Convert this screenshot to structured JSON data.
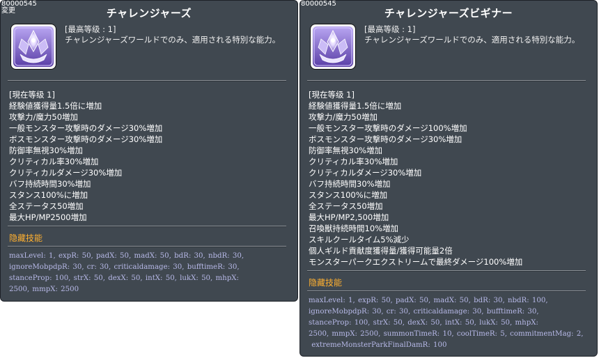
{
  "left": {
    "id": "80000545",
    "changed": "変更",
    "title": "チャレンジャーズ",
    "max_level": "[最高等级 : 1]",
    "description": "チャレンジャーズワールドでのみ、適用される特別な能力。",
    "current_level": "[現在等级 1]",
    "stats": [
      "経験値獲得量1.5倍に増加",
      "攻撃力/魔力50増加",
      "一般モンスター攻撃時のダメージ30%増加",
      "ボスモンスター攻撃時のダメージ30%増加",
      "防御率無視30%増加",
      "クリティカル率30%増加",
      "クリティカルダメージ30%増加",
      "バフ持続時間30%増加",
      "スタンス100%に増加",
      "全ステータス50増加",
      "最大HP/MP2500増加"
    ],
    "hidden_label": "隐藏技能",
    "code_lines": [
      "maxLevel: 1, expR: 50, padX: 50, madX: 50, bdR: 30, nbdR: 30,",
      "ignoreMobpdpR: 30, cr: 30, criticaldamage: 30, bufftimeR: 30,",
      "stanceProp: 100, strX: 50, dexX: 50, intX: 50, lukX: 50, mhpX:",
      "2500, mmpX: 2500"
    ]
  },
  "right": {
    "id": "80000545",
    "title": "チャレンジャーズビギナー",
    "max_level": "[最高等级 : 1]",
    "description": "チャレンジャーズワールドでのみ、適用される特別な能力。",
    "current_level": "[現在等级 1]",
    "stats": [
      "経験値獲得量1.5倍に増加",
      "攻撃力/魔力50増加",
      "一般モンスター攻撃時のダメージ100%増加",
      "ボスモンスター攻撃時のダメージ30%増加",
      "防御率無視30%増加",
      "クリティカル率30%増加",
      "クリティカルダメージ30%増加",
      "バフ持続時間30%増加",
      "スタンス100%に増加",
      "全ステータス50増加",
      "最大HP/MP2,500増加",
      "召喚獣持続時間10%増加",
      "スキルクールタイム5%減少",
      "個人ギルド貢献度獲得量/獲得可能量2倍",
      "モンスターパークエクストリームで最終ダメージ100%増加"
    ],
    "hidden_label": "隐藏技能",
    "code_lines": [
      "maxLevel: 1, expR: 50, padX: 50, madX: 50, bdR: 30, nbdR: 100,",
      "ignoreMobpdpR: 30, cr: 30, criticaldamage: 30, bufftimeR: 30,",
      "stanceProp: 100, strX: 50, dexX: 50, intX: 50, lukX: 50, mhpX:",
      "2500, mmpX: 2500, summonTimeR: 10, coolTimeR: 5, commitmentMag: 2,",
      " extremeMonsterParkFinalDamR: 100"
    ]
  },
  "colors": {
    "panel_bg": "#404850",
    "hidden_label": "#ffb030",
    "code_text": "#b7b9e8",
    "icon_purple": "#6a4fb0"
  },
  "icon": "crystal-crest-icon"
}
